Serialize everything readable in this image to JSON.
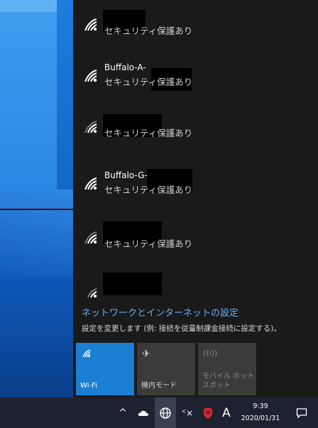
{
  "networks": [
    {
      "name": "",
      "security": "セキュリティ保護あり"
    },
    {
      "name": "Buffalo-A-",
      "security": "セキュリティ保護あり"
    },
    {
      "name": "",
      "security": "セキュリティ保護あり"
    },
    {
      "name": "Buffalo-G-",
      "security": "セキュリティ保護あり"
    },
    {
      "name": "",
      "security": "セキュリティ保護あり"
    },
    {
      "name": "",
      "security": ""
    }
  ],
  "settings": {
    "title": "ネットワークとインターネットの設定",
    "subtitle": "設定を変更します (例: 接続を従量制課金接続に設定する)。"
  },
  "quick_actions": [
    {
      "label": "Wi-Fi",
      "icon": "wifi-icon",
      "state": "on"
    },
    {
      "label": "機内モード",
      "icon": "airplane-icon",
      "state": "off"
    },
    {
      "label": "モバイル ホットスポット",
      "icon": "hotspot-icon",
      "state": "disabled"
    }
  ],
  "taskbar": {
    "ime": "A",
    "time": "9:39",
    "date": "2020/01/31",
    "chevron": "^",
    "mute_symbol": "ᑉ×"
  },
  "colors": {
    "accent": "#1b7fd3",
    "link": "#5cb3ff",
    "flyout_bg": "#1a1a1a",
    "taskbar_bg": "#1c2230"
  }
}
